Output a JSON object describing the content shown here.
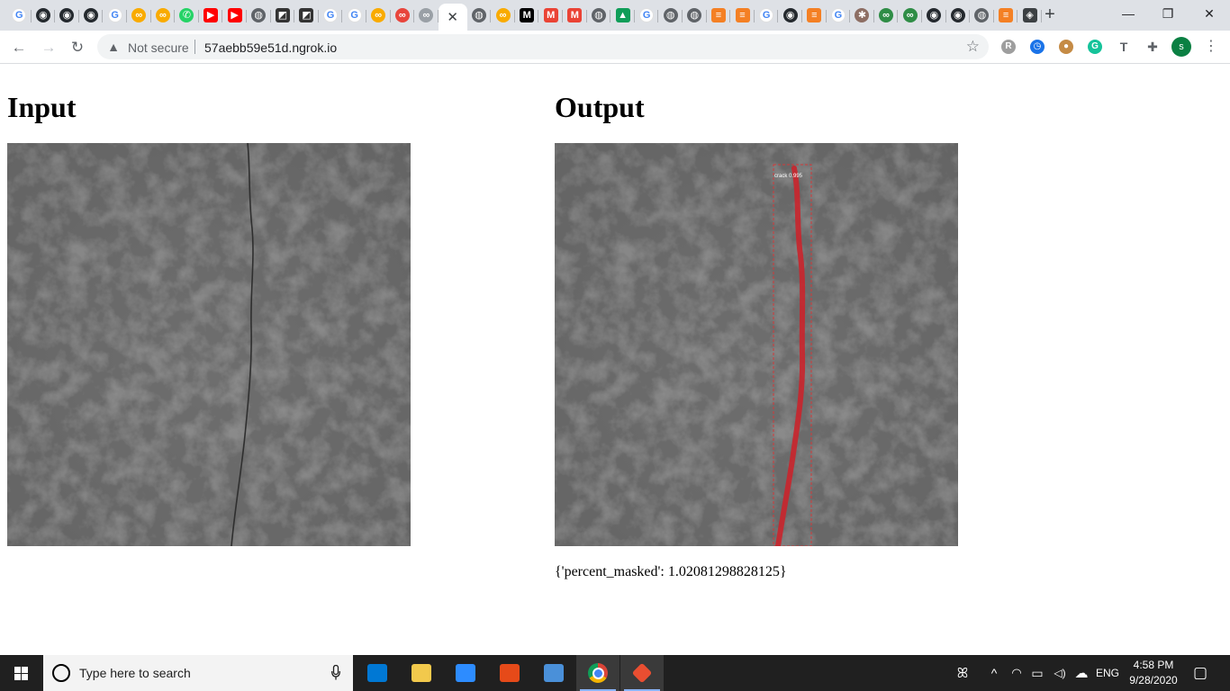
{
  "browser": {
    "tabs": [
      {
        "icon": "google-icon",
        "glyph": "G",
        "color": "#4285f4",
        "style": "google"
      },
      {
        "icon": "github-icon",
        "glyph": "◉",
        "color": "#24292e"
      },
      {
        "icon": "github-icon",
        "glyph": "◉",
        "color": "#24292e"
      },
      {
        "icon": "github-icon",
        "glyph": "◉",
        "color": "#24292e"
      },
      {
        "icon": "google-icon",
        "glyph": "G",
        "color": "#4285f4",
        "style": "google"
      },
      {
        "icon": "colab-icon",
        "glyph": "∞",
        "color": "#f9ab00"
      },
      {
        "icon": "colab-icon",
        "glyph": "∞",
        "color": "#f9ab00"
      },
      {
        "icon": "whatsapp-icon",
        "glyph": "✆",
        "color": "#25d366"
      },
      {
        "icon": "youtube-icon",
        "glyph": "▶",
        "color": "#ff0000",
        "style": "sq"
      },
      {
        "icon": "youtube-icon",
        "glyph": "▶",
        "color": "#ff0000",
        "style": "sq"
      },
      {
        "icon": "globe-icon",
        "glyph": "◍",
        "color": "#5f6368"
      },
      {
        "icon": "notion-icon",
        "glyph": "◩",
        "color": "#333333",
        "style": "sq"
      },
      {
        "icon": "notion-icon",
        "glyph": "◩",
        "color": "#333333",
        "style": "sq"
      },
      {
        "icon": "google-icon",
        "glyph": "G",
        "color": "#4285f4",
        "style": "google"
      },
      {
        "icon": "google-icon",
        "glyph": "G",
        "color": "#4285f4",
        "style": "google"
      },
      {
        "icon": "colab-icon",
        "glyph": "∞",
        "color": "#f9ab00"
      },
      {
        "icon": "colab-icon",
        "glyph": "∞",
        "color": "#e8453c"
      },
      {
        "icon": "colab-icon",
        "glyph": "∞",
        "color": "#9aa0a6"
      },
      {
        "icon": "close-icon",
        "glyph": "✕",
        "color": "#ffffff",
        "active": true
      },
      {
        "icon": "globe-icon",
        "glyph": "◍",
        "color": "#5f6368"
      },
      {
        "icon": "colab-icon",
        "glyph": "∞",
        "color": "#f9ab00"
      },
      {
        "icon": "medium-icon",
        "glyph": "M",
        "color": "#000000",
        "style": "sq"
      },
      {
        "icon": "gmail-icon",
        "glyph": "M",
        "color": "#ea4335",
        "style": "sq"
      },
      {
        "icon": "gmail-icon",
        "glyph": "M",
        "color": "#ea4335",
        "style": "sq"
      },
      {
        "icon": "globe-icon",
        "glyph": "◍",
        "color": "#5f6368"
      },
      {
        "icon": "google-drive-icon",
        "glyph": "▲",
        "color": "#0f9d58",
        "style": "sq"
      },
      {
        "icon": "google-icon",
        "glyph": "G",
        "color": "#4285f4",
        "style": "google"
      },
      {
        "icon": "globe-icon",
        "glyph": "◍",
        "color": "#5f6368"
      },
      {
        "icon": "globe-icon",
        "glyph": "◍",
        "color": "#5f6368"
      },
      {
        "icon": "stackoverflow-icon",
        "glyph": "≡",
        "color": "#f48024",
        "style": "sq"
      },
      {
        "icon": "stackoverflow-icon",
        "glyph": "≡",
        "color": "#f48024",
        "style": "sq"
      },
      {
        "icon": "google-icon",
        "glyph": "G",
        "color": "#4285f4",
        "style": "google"
      },
      {
        "icon": "github-icon",
        "glyph": "◉",
        "color": "#24292e"
      },
      {
        "icon": "stackoverflow-icon",
        "glyph": "≡",
        "color": "#f48024",
        "style": "sq"
      },
      {
        "icon": "google-icon",
        "glyph": "G",
        "color": "#4285f4",
        "style": "google"
      },
      {
        "icon": "compass-icon",
        "glyph": "✱",
        "color": "#8d6e63"
      },
      {
        "icon": "geeksforgeeks-icon",
        "glyph": "∞",
        "color": "#2f8d46"
      },
      {
        "icon": "geeksforgeeks-icon",
        "glyph": "∞",
        "color": "#2f8d46"
      },
      {
        "icon": "github-icon",
        "glyph": "◉",
        "color": "#24292e"
      },
      {
        "icon": "github-icon",
        "glyph": "◉",
        "color": "#24292e"
      },
      {
        "icon": "globe-icon",
        "glyph": "◍",
        "color": "#5f6368"
      },
      {
        "icon": "stackoverflow-icon",
        "glyph": "≡",
        "color": "#f48024",
        "style": "sq"
      },
      {
        "icon": "diamond-icon",
        "glyph": "◈",
        "color": "#3c4043",
        "style": "sq"
      }
    ],
    "new_tab_glyph": "+",
    "window_controls": {
      "minimize": "—",
      "restore": "❐",
      "close": "✕"
    },
    "nav": {
      "back": "←",
      "forward": "→",
      "reload": "↻"
    },
    "security_label": "Not secure",
    "url": "57aebb59e51d.ngrok.io",
    "star_glyph": "☆",
    "extensions": [
      {
        "icon": "extension-r-icon",
        "glyph": "R",
        "color": "#9e9e9e"
      },
      {
        "icon": "clock-extension-icon",
        "glyph": "◷",
        "color": "#1a73e8"
      },
      {
        "icon": "cookie-extension-icon",
        "glyph": "●",
        "color": "#c58b45"
      },
      {
        "icon": "grammarly-icon",
        "glyph": "G",
        "color": "#15c39a"
      },
      {
        "icon": "translate-extension-icon",
        "glyph": "T",
        "color": "#5f6368"
      },
      {
        "icon": "puzzle-icon",
        "glyph": "✚",
        "color": "#5f6368"
      }
    ],
    "profile_initial": "s",
    "menu_glyph": "⋮"
  },
  "page": {
    "input_heading": "Input",
    "output_heading": "Output",
    "detection_label": "crack 0.995",
    "result_text": "{'percent_masked': 1.02081298828125}"
  },
  "taskbar": {
    "search_placeholder": "Type here to search",
    "apps": [
      {
        "icon": "mail-icon",
        "color": "#0078d4"
      },
      {
        "icon": "file-explorer-icon",
        "color": "#f2c94c"
      },
      {
        "icon": "zoom-icon",
        "color": "#2d8cff"
      },
      {
        "icon": "paint-app-icon",
        "color": "#e64a19"
      },
      {
        "icon": "remote-desktop-icon",
        "color": "#4a90d9"
      },
      {
        "icon": "chrome-icon",
        "color": "#db4437",
        "active": true
      },
      {
        "icon": "git-icon",
        "color": "#e94e31",
        "active": true
      }
    ],
    "tray": {
      "people_glyph": "ꕤ",
      "chevron_glyph": "^",
      "wifi_glyph": "◠",
      "battery_glyph": "▭",
      "volume_glyph": "◁)",
      "cloud_glyph": "☁",
      "language": "ENG",
      "time": "4:58 PM",
      "date": "9/28/2020",
      "notification_glyph": "▢"
    }
  }
}
